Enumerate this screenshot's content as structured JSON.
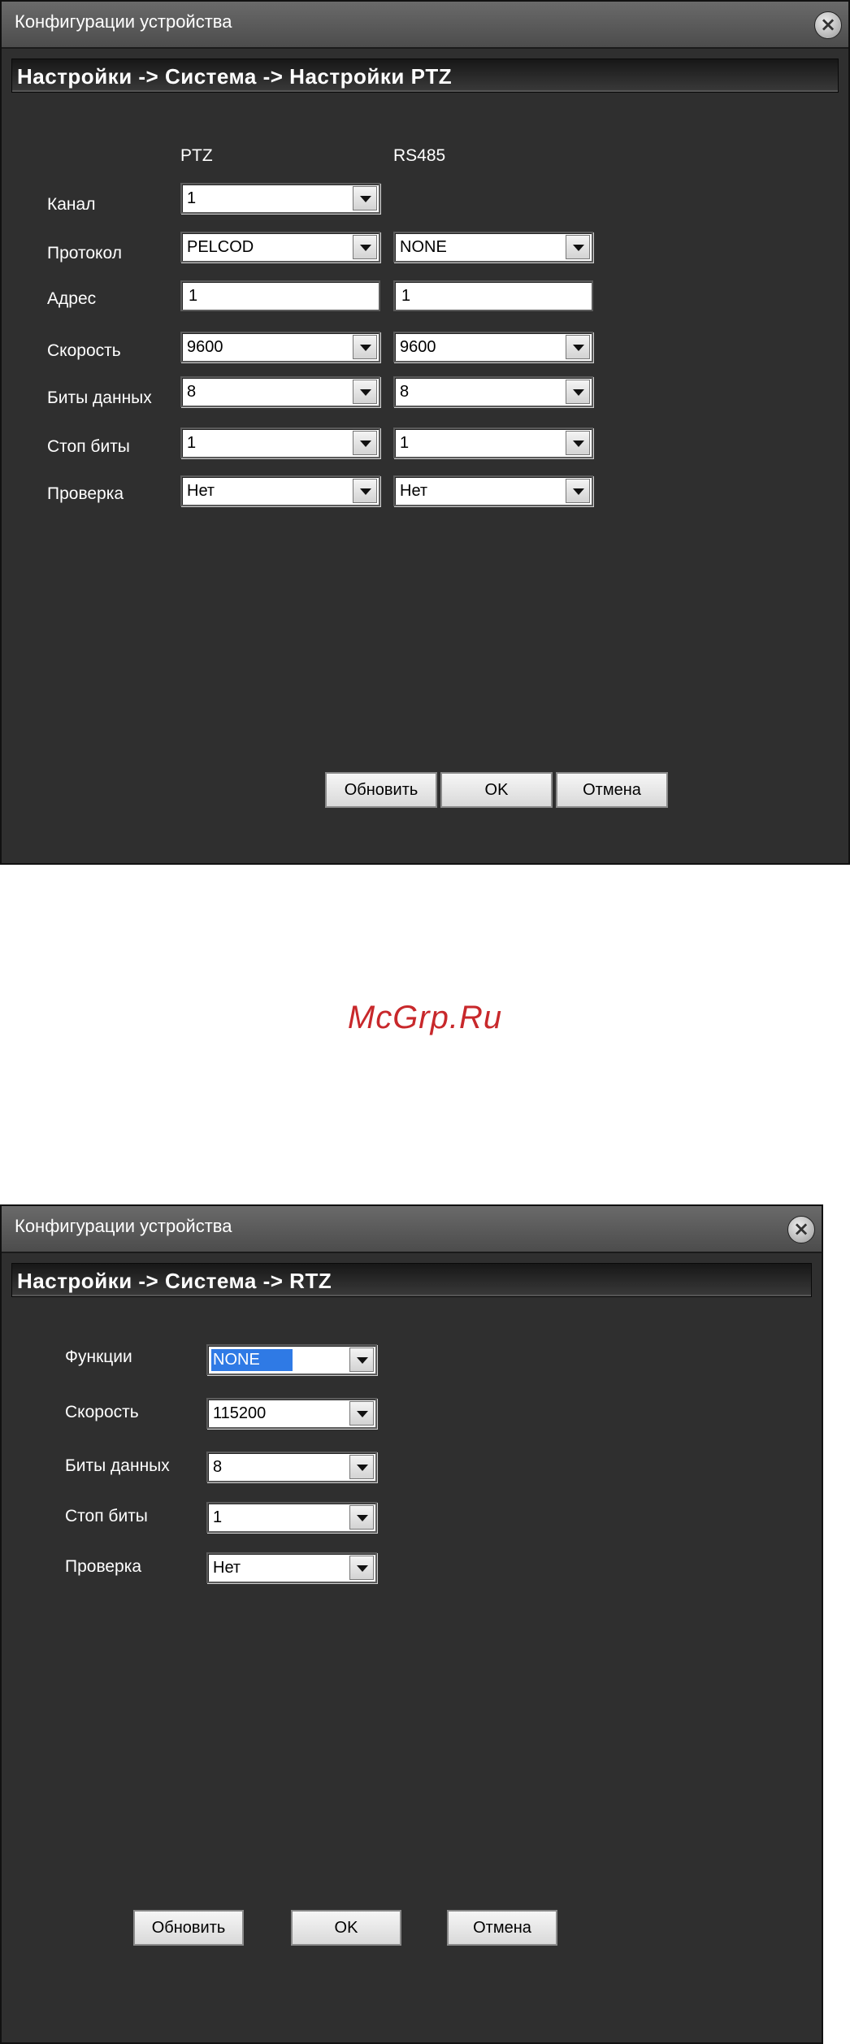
{
  "dialog1": {
    "title": "Конфигурации устройства",
    "breadcrumb": "Настройки -> Система -> Настройки PTZ",
    "column_headers": {
      "ptz": "PTZ",
      "rs485": "RS485"
    },
    "labels": {
      "channel": "Канал",
      "protocol": "Протокол",
      "address": "Адрес",
      "speed": "Скорость",
      "data_bits": "Биты данных",
      "stop_bits": "Стоп биты",
      "parity": "Проверка"
    },
    "ptz": {
      "channel": "1",
      "protocol": "PELCOD",
      "address": "1",
      "speed": "9600",
      "data_bits": "8",
      "stop_bits": "1",
      "parity": "Нет"
    },
    "rs485": {
      "protocol": "NONE",
      "address": "1",
      "speed": "9600",
      "data_bits": "8",
      "stop_bits": "1",
      "parity": "Нет"
    },
    "buttons": {
      "refresh": "Обновить",
      "ok": "OK",
      "cancel": "Отмена"
    }
  },
  "watermark": "McGrp.Ru",
  "dialog2": {
    "title": "Конфигурации устройства",
    "breadcrumb": "Настройки -> Система -> RTZ",
    "labels": {
      "functions": "Функции",
      "speed": "Скорость",
      "data_bits": "Биты данных",
      "stop_bits": "Стоп биты",
      "parity": "Проверка"
    },
    "values": {
      "functions": "NONE",
      "speed": "115200",
      "data_bits": "8",
      "stop_bits": "1",
      "parity": "Нет"
    },
    "buttons": {
      "refresh": "Обновить",
      "ok": "OK",
      "cancel": "Отмена"
    }
  },
  "colors": {
    "panel_bg": "#2f2f2f",
    "selection_highlight": "#2f7ae5",
    "watermark": "#c8282b"
  }
}
